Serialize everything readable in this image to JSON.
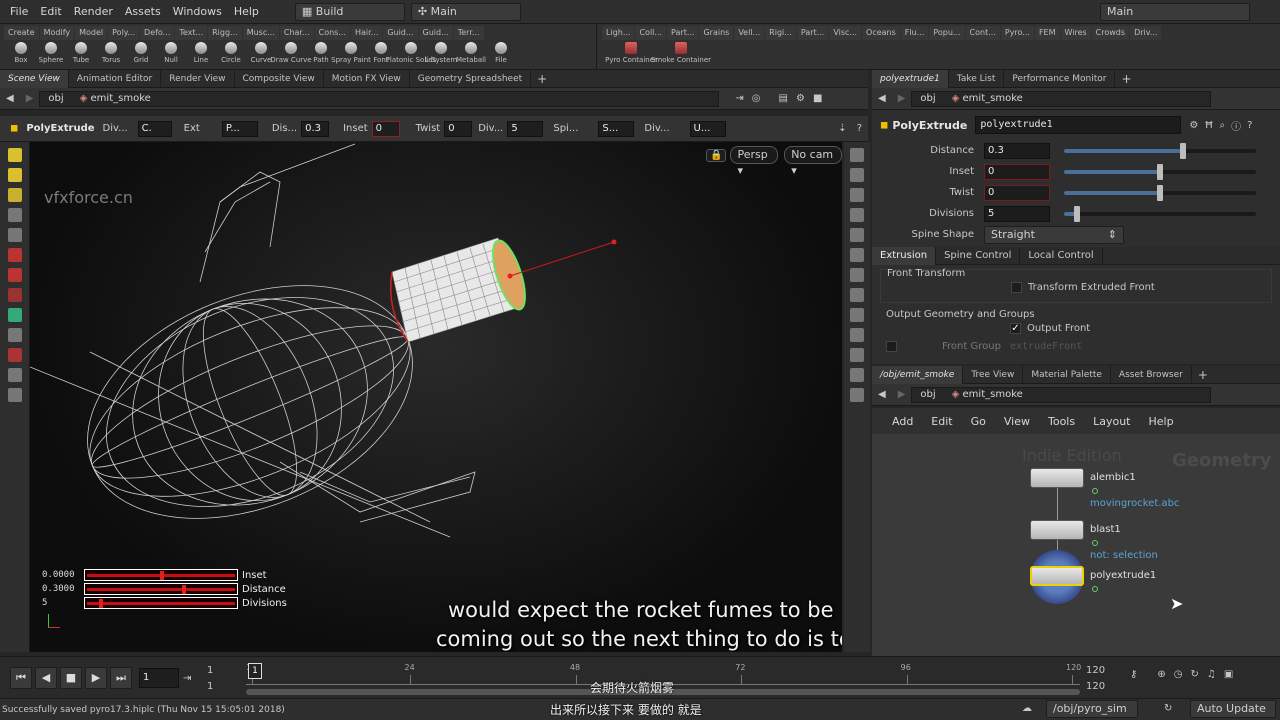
{
  "menubar": {
    "items": [
      "File",
      "Edit",
      "Render",
      "Assets",
      "Windows",
      "Help"
    ],
    "desktop": "Build",
    "layout": "Main",
    "right_desktop": "Main"
  },
  "shelf": {
    "left_tabs": [
      "Create",
      "Modify",
      "Model",
      "Poly...",
      "Defo...",
      "Text...",
      "Rigg...",
      "Musc...",
      "Char...",
      "Cons...",
      "Hair...",
      "Guid...",
      "Guid...",
      "Terr..."
    ],
    "tools": [
      "Box",
      "Sphere",
      "Tube",
      "Torus",
      "Grid",
      "Null",
      "Line",
      "Circle",
      "Curve",
      "Draw Curve",
      "Path",
      "Spray Paint",
      "Font",
      "Platonic Solids",
      "L-System",
      "Metaball",
      "File"
    ],
    "right_tabs": [
      "Ligh...",
      "Coll...",
      "Part...",
      "Grains",
      "Vell...",
      "Rigi...",
      "Part...",
      "Visc...",
      "Oceans",
      "Flu...",
      "Popu...",
      "Cont...",
      "Pyro...",
      "FEM",
      "Wires",
      "Crowds",
      "Driv..."
    ],
    "right_tools": [
      "Pyro Container",
      "Smoke Container"
    ]
  },
  "left_pane": {
    "tabs": [
      "Scene View",
      "Animation Editor",
      "Render View",
      "Composite View",
      "Motion FX View",
      "Geometry Spreadsheet"
    ],
    "path": [
      "obj",
      "emit_smoke"
    ]
  },
  "op_toolbar": {
    "node_type": "PolyExtrude",
    "div_label": "Div...",
    "ext_label": "Ext",
    "ext_value": "P...",
    "distance_label": "Dis...",
    "distance_value": "0.3",
    "inset_label": "Inset",
    "inset_value": "0",
    "twist_label": "Twist",
    "twist_value": "0",
    "divisions_label": "Div...",
    "divisions_value": "5",
    "spine_label": "Spi...",
    "spine_value": "S...",
    "div2_label": "Div...",
    "div2_value": "U..."
  },
  "viewport": {
    "persp": "Persp",
    "cam": "No cam",
    "watermark": "vfxforce.cn",
    "hud": [
      {
        "value": "0.0000",
        "label": "Inset",
        "frac": 0.5
      },
      {
        "value": "0.3000",
        "label": "Distance",
        "frac": 0.65
      },
      {
        "value": "5",
        "label": "Divisions",
        "frac": 0.08
      }
    ],
    "subtitle_en_1": "would expect the rocket fumes to be",
    "subtitle_en_2": "coming out so the next thing to do is to"
  },
  "param_pane": {
    "tabs": [
      "polyextrude1",
      "Take List",
      "Performance Monitor"
    ],
    "path": [
      "obj",
      "emit_smoke"
    ],
    "node_type": "PolyExtrude",
    "node_name": "polyextrude1",
    "params": [
      {
        "label": "Distance",
        "value": "0.3",
        "frac": 0.62,
        "red": false
      },
      {
        "label": "Inset",
        "value": "0",
        "frac": 0.5,
        "red": true
      },
      {
        "label": "Twist",
        "value": "0",
        "frac": 0.5,
        "red": true
      },
      {
        "label": "Divisions",
        "value": "5",
        "frac": 0.07,
        "red": false
      }
    ],
    "spine_shape_label": "Spine Shape",
    "spine_shape_value": "Straight",
    "subtabs": [
      "Extrusion",
      "Spine Control",
      "Local Control"
    ],
    "front_transform": "Front Transform",
    "transform_extruded_front": "Transform Extruded Front",
    "output_group": "Output Geometry and Groups",
    "output_front": "Output Front",
    "front_group_label": "Front Group",
    "front_group_value": "extrudeFront"
  },
  "network_pane": {
    "tabs": [
      "/obj/emit_smoke",
      "Tree View",
      "Material Palette",
      "Asset Browser"
    ],
    "path": [
      "obj",
      "emit_smoke"
    ],
    "menu": [
      "Add",
      "Edit",
      "Go",
      "View",
      "Tools",
      "Layout",
      "Help"
    ],
    "watermark_left": "Indie Edition",
    "watermark_right": "Geometry",
    "nodes": [
      {
        "name": "alembic1",
        "sub": "movingrocket.abc"
      },
      {
        "name": "blast1",
        "sub": "not: selection"
      },
      {
        "name": "polyextrude1",
        "sub": ""
      }
    ]
  },
  "timeline": {
    "frame": "1",
    "start_a": "1",
    "start_b": "1",
    "ticks": [
      "1",
      "24",
      "48",
      "72",
      "96",
      "120"
    ],
    "end_a": "120",
    "end_b": "120",
    "subtitle_cn_1": "会期待火箭烟雾",
    "subtitle_cn_2": "出来所以接下来 要做的 就是"
  },
  "status": {
    "message": "Successfully saved pyro17.3.hiplc (Thu Nov 15 15:05:01 2018)",
    "path": "/obj/pyro_sim",
    "update_mode": "Auto Update"
  },
  "colors": {
    "accent_blue": "#4a6f98",
    "node_selected": "#f0d000",
    "guide_red": "#d01818",
    "link_blue": "#5aa3d6"
  }
}
